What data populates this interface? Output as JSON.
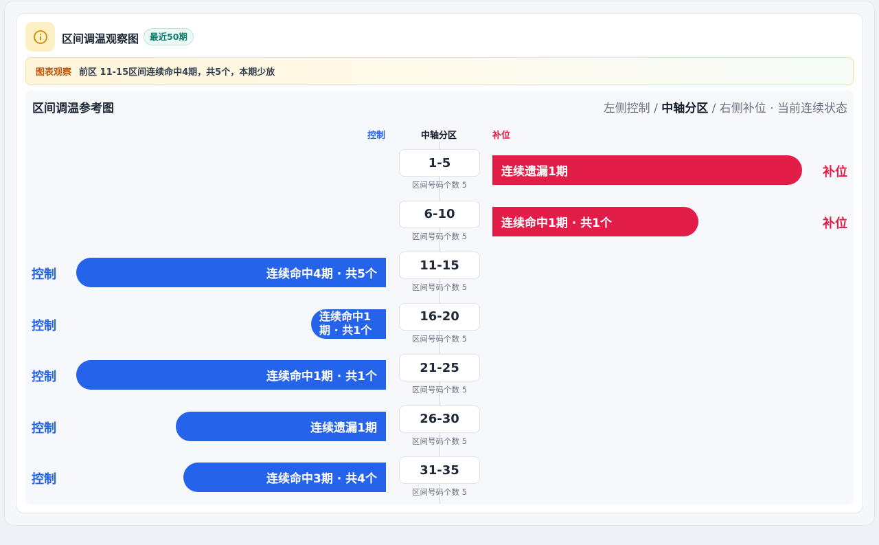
{
  "header": {
    "title": "区间调温观察图",
    "badge": "最近50期"
  },
  "note": {
    "tag": "图表观察",
    "text": "前区 11-15区间连续命中4期，共5个，本期少放"
  },
  "panel": {
    "title": "区间调温参考图",
    "legend": {
      "left": "左侧控制",
      "sep1": " / ",
      "mid": "中轴分区",
      "sep2": " / ",
      "right": "右侧补位",
      "dot": " · ",
      "state": "当前连续状态"
    },
    "col_headers": {
      "left": "控制",
      "mid": "中轴分区",
      "right": "补位"
    }
  },
  "colors": {
    "control": "#2563eb",
    "fill": "#e11d48"
  },
  "rows": [
    {
      "zone": "1-5",
      "sub": "区间号码个数 5",
      "side": "right",
      "side_label": "补位",
      "bar_text": "连续遗漏1期",
      "level": 0.87
    },
    {
      "zone": "6-10",
      "sub": "区间号码个数 5",
      "side": "right",
      "side_label": "补位",
      "bar_text": "连续命中1期 · 共1个",
      "level": 0.58
    },
    {
      "zone": "11-15",
      "sub": "区间号码个数 5",
      "side": "left",
      "side_label": "控制",
      "bar_text": "连续命中4期 · 共5个",
      "level": 0.87
    },
    {
      "zone": "16-20",
      "sub": "区间号码个数 5",
      "side": "left",
      "side_label": "控制",
      "bar_text": "连续命中1期 · 共1个",
      "level": 0.21
    },
    {
      "zone": "21-25",
      "sub": "区间号码个数 5",
      "side": "left",
      "side_label": "控制",
      "bar_text": "连续命中1期 · 共1个",
      "level": 0.87
    },
    {
      "zone": "26-30",
      "sub": "区间号码个数 5",
      "side": "left",
      "side_label": "控制",
      "bar_text": "连续遗漏1期",
      "level": 0.59
    },
    {
      "zone": "31-35",
      "sub": "区间号码个数 5",
      "side": "left",
      "side_label": "控制",
      "bar_text": "连续命中3期 · 共4个",
      "level": 0.57
    }
  ]
}
